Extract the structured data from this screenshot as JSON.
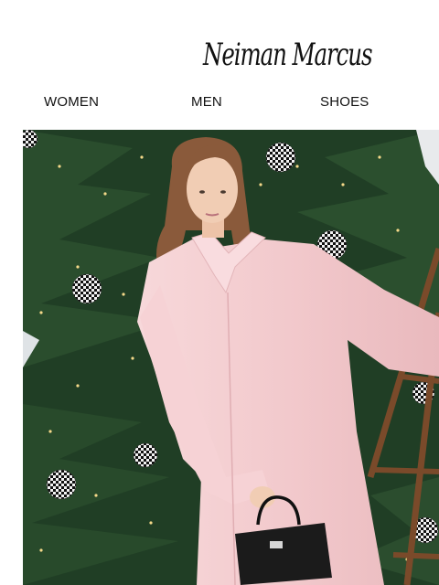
{
  "brand": {
    "logo_text": "Neiman Marcus"
  },
  "nav": {
    "items": [
      {
        "label": "WOMEN"
      },
      {
        "label": "MEN"
      },
      {
        "label": "SHOES"
      }
    ]
  },
  "hero": {
    "colors": {
      "tree": "#1f3a22",
      "coat": "#f4cfd2",
      "hair": "#8c5a3a",
      "bag": "#1a1a1a",
      "ladder": "#7a4a2a",
      "sky": "#e9ecef"
    },
    "icons": [
      "checkered-ornament-icon",
      "handbag-icon",
      "ladder-icon"
    ]
  }
}
